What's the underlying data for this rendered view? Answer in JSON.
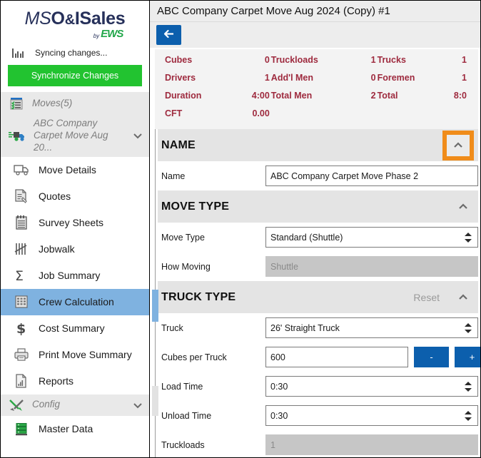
{
  "brand": {
    "logo_light": "MSO",
    "logo_bold_1": "O&",
    "logo_bold_2": "ISales",
    "logo_full": "MSO&ISales",
    "by_text": "by",
    "company": "EWS",
    "navy": "#26305a",
    "green": "#22a74a"
  },
  "sidebar": {
    "sync_status": "Syncing changes...",
    "sync_button": "Synchronize Changes",
    "groups": [
      {
        "label": "Moves(5)",
        "icon": "moves-list-icon"
      },
      {
        "label": "ABC Company Carpet Move Aug 20...",
        "icon": "truck-icon"
      }
    ],
    "items": [
      {
        "label": "Move Details",
        "icon": "truck-outline-icon",
        "active": false
      },
      {
        "label": "Quotes",
        "icon": "quote-document-icon",
        "active": false
      },
      {
        "label": "Survey Sheets",
        "icon": "notepad-icon",
        "active": false
      },
      {
        "label": "Jobwalk",
        "icon": "tally-marks-icon",
        "active": false
      },
      {
        "label": "Job Summary",
        "icon": "sigma-icon",
        "active": false
      },
      {
        "label": "Crew Calculation",
        "icon": "calculator-icon",
        "active": true
      },
      {
        "label": "Cost Summary",
        "icon": "dollar-icon",
        "active": false
      },
      {
        "label": "Print Move Summary",
        "icon": "printer-icon",
        "active": false
      },
      {
        "label": "Reports",
        "icon": "report-chart-icon",
        "active": false
      }
    ],
    "config_group": {
      "label": "Config",
      "icon": "wrench-screwdriver-icon"
    },
    "config_items": [
      {
        "label": "Master Data",
        "icon": "database-icon"
      }
    ]
  },
  "header": {
    "title": "ABC Company Carpet Move Aug 2024 (Copy) #1",
    "back_icon": "back-arrow-icon",
    "back_label": "←",
    "accent_blue": "#0c5fad"
  },
  "stats": {
    "text_color": "#9e2a3e",
    "rows": [
      [
        {
          "key": "Cubes",
          "value": "0"
        },
        {
          "key": "Truckloads",
          "value": "1"
        },
        {
          "key": "Trucks",
          "value": "1"
        }
      ],
      [
        {
          "key": "Drivers",
          "value": "1"
        },
        {
          "key": "Add'l Men",
          "value": "0"
        },
        {
          "key": "Foremen",
          "value": "1"
        }
      ],
      [
        {
          "key": "Duration",
          "value": "4:00"
        },
        {
          "key": "Total Men",
          "value": "2"
        },
        {
          "key": "Total",
          "value": "8:0"
        }
      ],
      [
        {
          "key": "CFT",
          "value": "0.00"
        },
        {
          "key": "",
          "value": ""
        },
        {
          "key": "",
          "value": ""
        }
      ]
    ]
  },
  "sections": {
    "name": {
      "title": "NAME",
      "collapse_icon": "chevron-up-icon",
      "highlighted": true,
      "fields": [
        {
          "label": "Name",
          "value": "ABC Company Carpet Move Phase 2",
          "type": "text",
          "name": "name-input"
        }
      ]
    },
    "move_type": {
      "title": "MOVE TYPE",
      "collapse_icon": "chevron-up-icon",
      "fields": [
        {
          "label": "Move Type",
          "value": "Standard (Shuttle)",
          "type": "select",
          "name": "move-type-select"
        },
        {
          "label": "How Moving",
          "value": "Shuttle",
          "type": "readonly",
          "name": "how-moving-readonly"
        }
      ]
    },
    "truck_type": {
      "title": "TRUCK TYPE",
      "reset_label": "Reset",
      "collapse_icon": "chevron-up-icon",
      "fields": [
        {
          "label": "Truck",
          "value": "26' Straight Truck",
          "type": "select",
          "name": "truck-select"
        },
        {
          "label": "Cubes per Truck",
          "value": "600",
          "type": "stepper",
          "name": "cubes-per-truck-input",
          "minus": "-",
          "plus": "+"
        },
        {
          "label": "Load Time",
          "value": "0:30",
          "type": "select",
          "name": "load-time-select"
        },
        {
          "label": "Unload Time",
          "value": "0:30",
          "type": "select",
          "name": "unload-time-select"
        },
        {
          "label": "Truckloads",
          "value": "1",
          "type": "readonly",
          "name": "truckloads-readonly"
        }
      ]
    }
  },
  "highlight": {
    "color": "#f08c1a"
  }
}
